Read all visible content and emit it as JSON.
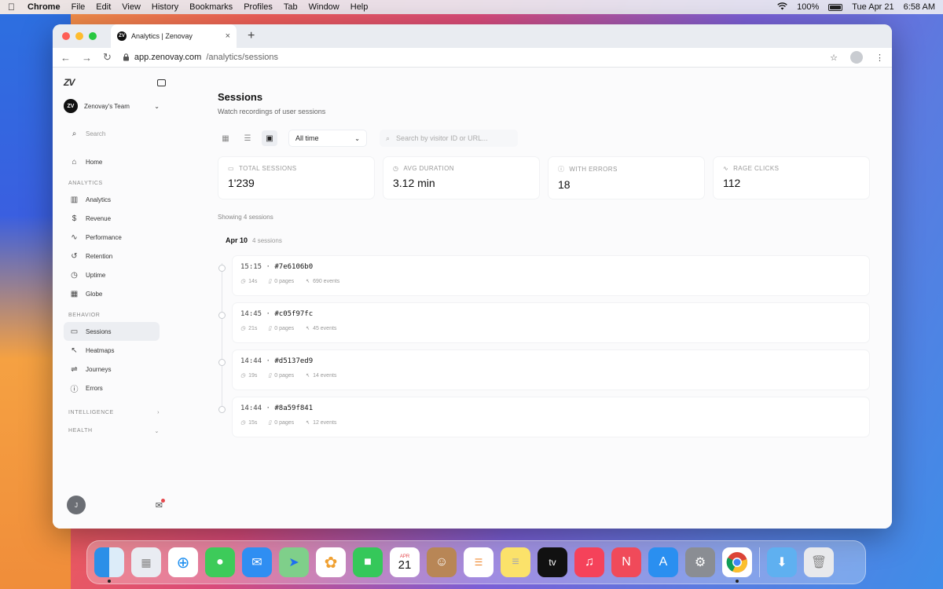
{
  "menubar": {
    "app": "Chrome",
    "items": [
      "File",
      "Edit",
      "View",
      "History",
      "Bookmarks",
      "Profiles",
      "Tab",
      "Window",
      "Help"
    ],
    "battery": "100%",
    "date": "Tue Apr 21",
    "time": "6:58 AM"
  },
  "browser": {
    "tab_title": "Analytics | Zenovay",
    "url_host": "app.zenovay.com",
    "url_path": "/analytics/sessions"
  },
  "sidebar": {
    "logo": "ZV",
    "team_name": "Zenovay's Team",
    "search_placeholder": "Search",
    "home": "Home",
    "section_analytics": "ANALYTICS",
    "analytics_items": [
      "Analytics",
      "Revenue",
      "Performance",
      "Retention",
      "Uptime",
      "Globe"
    ],
    "section_behavior": "BEHAVIOR",
    "behavior_items": [
      "Sessions",
      "Heatmaps",
      "Journeys",
      "Errors"
    ],
    "section_intelligence": "INTELLIGENCE",
    "section_health": "HEALTH",
    "user_initial": "J"
  },
  "main": {
    "title": "Sessions",
    "subtitle": "Watch recordings of user sessions",
    "range_select": "All time",
    "search_placeholder": "Search by visitor ID or URL...",
    "stats": [
      {
        "label": "TOTAL SESSIONS",
        "value": "1'239",
        "icon": "video-icon"
      },
      {
        "label": "AVG DURATION",
        "value": "3.12 min",
        "icon": "clock-icon"
      },
      {
        "label": "WITH ERRORS",
        "value": "18",
        "icon": "alert-icon"
      },
      {
        "label": "RAGE CLICKS",
        "value": "112",
        "icon": "pulse-icon"
      }
    ],
    "showing": "Showing 4 sessions",
    "group_date": "Apr 10",
    "group_count": "4 sessions",
    "sessions": [
      {
        "time": "15:15",
        "id": "#7e6106b0",
        "duration": "14s",
        "pages": "0 pages",
        "events": "690 events"
      },
      {
        "time": "14:45",
        "id": "#c05f97fc",
        "duration": "21s",
        "pages": "0 pages",
        "events": "45 events"
      },
      {
        "time": "14:44",
        "id": "#d5137ed9",
        "duration": "19s",
        "pages": "0 pages",
        "events": "14 events"
      },
      {
        "time": "14:44",
        "id": "#8a59f841",
        "duration": "15s",
        "pages": "0 pages",
        "events": "12 events"
      }
    ]
  },
  "dock": {
    "calendar_month": "APR",
    "calendar_day": "21",
    "tv_label": "tv"
  }
}
